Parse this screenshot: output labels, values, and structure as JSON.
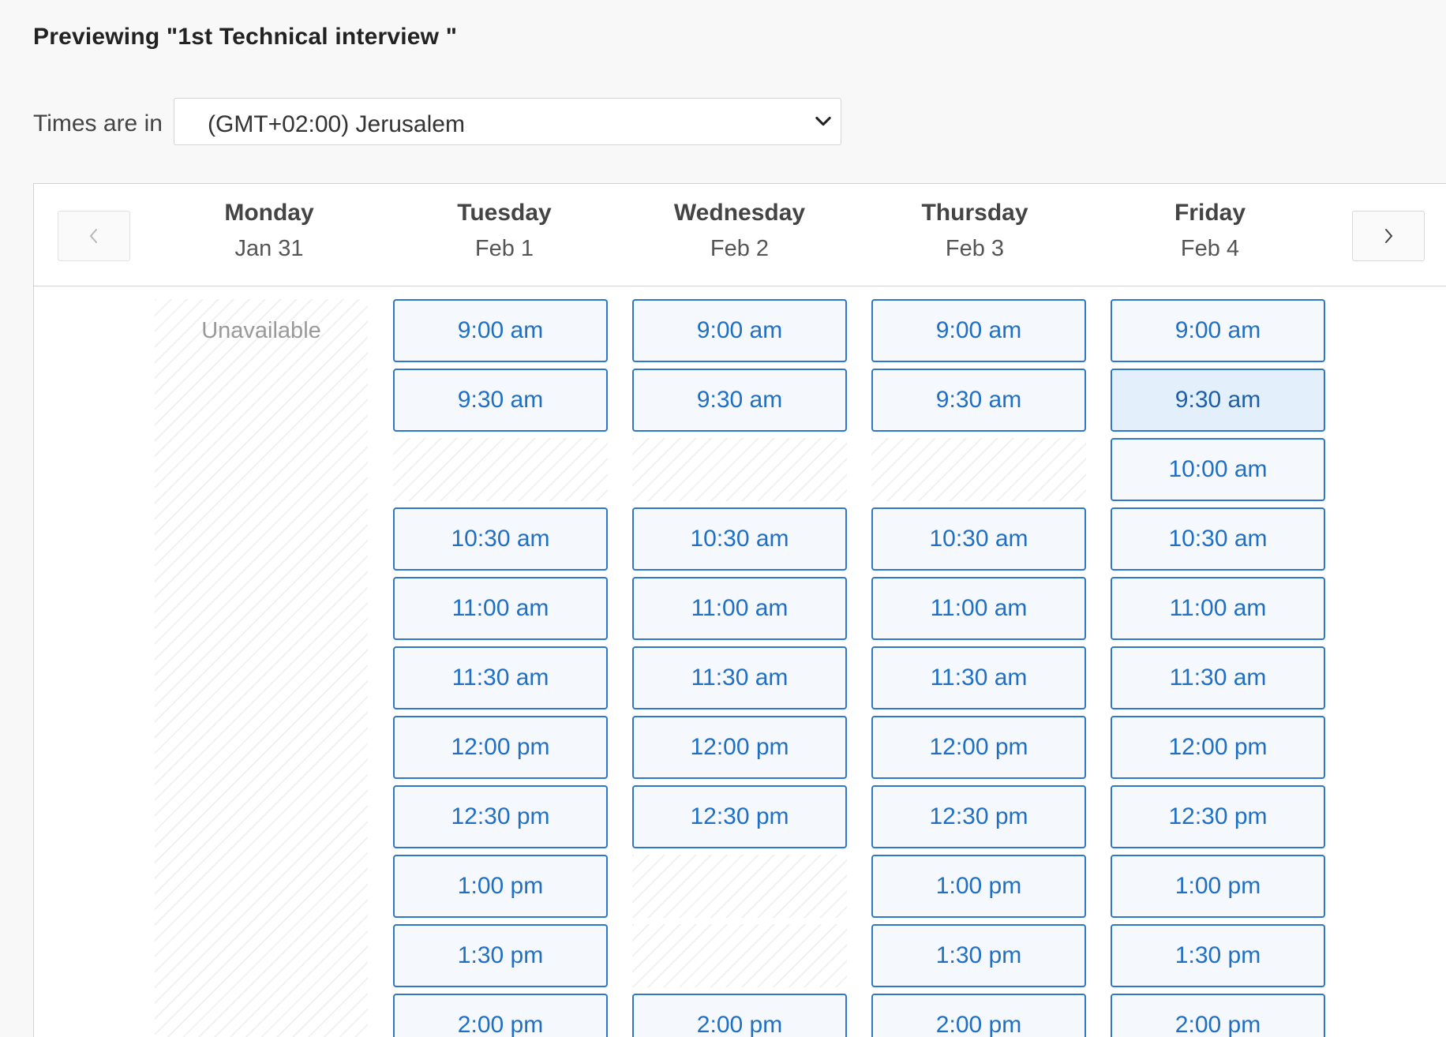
{
  "page": {
    "title": "Previewing \"1st Technical interview \""
  },
  "timezone": {
    "label": "Times are in",
    "selected": "(GMT+02:00) Jerusalem"
  },
  "calendar": {
    "prev_icon": "chevron-left-icon",
    "next_icon": "chevron-right-icon",
    "days": [
      {
        "name": "Monday",
        "date": "Jan 31",
        "unavailable_label": "Unavailable"
      },
      {
        "name": "Tuesday",
        "date": "Feb 1"
      },
      {
        "name": "Wednesday",
        "date": "Feb 2"
      },
      {
        "name": "Thursday",
        "date": "Feb 3"
      },
      {
        "name": "Friday",
        "date": "Feb 4"
      }
    ],
    "slots": {
      "tuesday": [
        "9:00 am",
        "9:30 am",
        "10:30 am",
        "11:00 am",
        "11:30 am",
        "12:00 pm",
        "12:30 pm",
        "1:00 pm",
        "1:30 pm",
        "2:00 pm"
      ],
      "wednesday": [
        "9:00 am",
        "9:30 am",
        "10:30 am",
        "11:00 am",
        "11:30 am",
        "12:00 pm",
        "12:30 pm",
        "2:00 pm"
      ],
      "thursday": [
        "9:00 am",
        "9:30 am",
        "10:30 am",
        "11:00 am",
        "11:30 am",
        "12:00 pm",
        "12:30 pm",
        "1:00 pm",
        "1:30 pm",
        "2:00 pm"
      ],
      "friday": [
        "9:00 am",
        "9:30 am",
        "10:00 am",
        "10:30 am",
        "11:00 am",
        "11:30 am",
        "12:00 pm",
        "12:30 pm",
        "1:00 pm",
        "1:30 pm",
        "2:00 pm"
      ]
    },
    "colors": {
      "slot_border": "#2f77c8",
      "slot_text": "#1f6fc5",
      "slot_bg": "#f5f9fd",
      "slot_hover_bg": "#e3effa"
    }
  }
}
